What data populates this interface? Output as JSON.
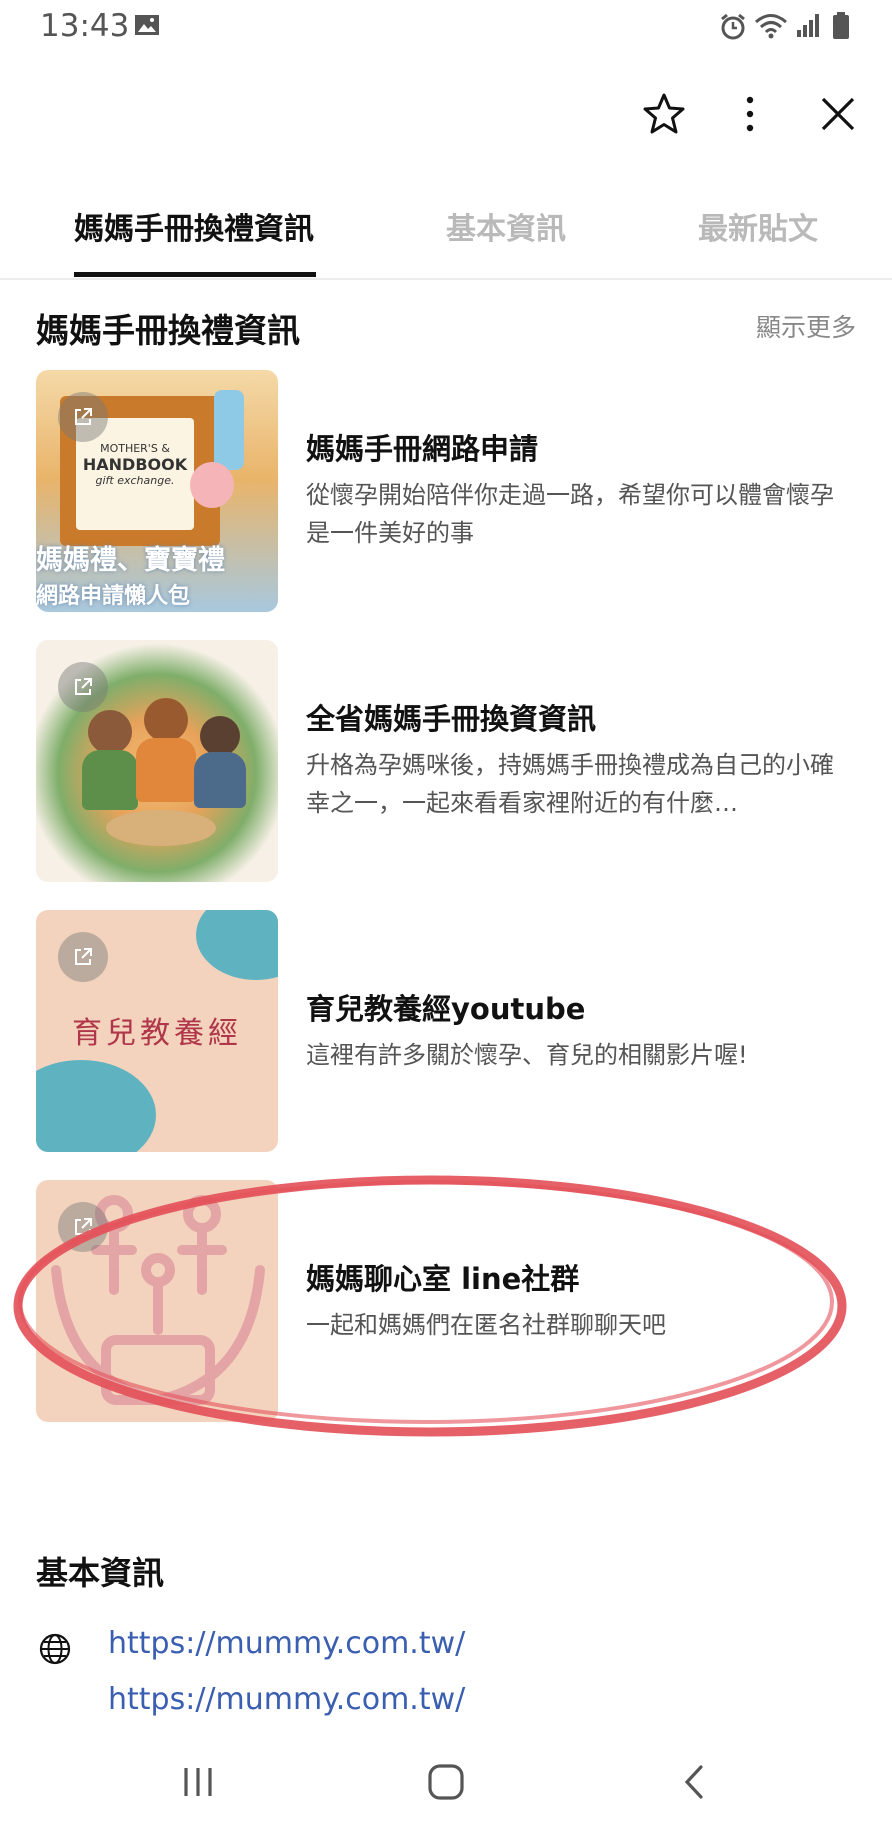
{
  "status": {
    "time": "13:43"
  },
  "tabs": [
    {
      "label": "媽媽手冊換禮資訊",
      "active": true
    },
    {
      "label": "基本資訊",
      "active": false
    },
    {
      "label": "最新貼文",
      "active": false
    }
  ],
  "section": {
    "title": "媽媽手冊換禮資訊",
    "show_more": "顯示更多"
  },
  "items": [
    {
      "title": "媽媽手冊網路申請",
      "desc": "從懷孕開始陪伴你走過一路，希望你可以體會懷孕是一件美好的事",
      "thumb": {
        "text1": "MOTHER'S &",
        "text2": "HANDBOOK",
        "text3": "gift exchange.",
        "caption1": "媽媽禮、寶寶禮",
        "caption2": "網路申請懶人包"
      }
    },
    {
      "title": "全省媽媽手冊換資資訊",
      "desc": "升格為孕媽咪後，持媽媽手冊換禮成為自己的小確幸之一，一起來看看家裡附近的有什麼…"
    },
    {
      "title": "育兒教養經youtube",
      "desc": "這裡有許多關於懷孕、育兒的相關影片喔!",
      "thumb": {
        "caption": "育兒教養經"
      }
    },
    {
      "title": "媽媽聊心室 line社群",
      "desc": "一起和媽媽們在匿名社群聊聊天吧"
    }
  ],
  "basic": {
    "title": "基本資訊",
    "links": [
      "https://mummy.com.tw/",
      "https://mummy.com.tw/"
    ]
  },
  "colors": {
    "highlight": "#e4525a",
    "link": "#3a5eb0"
  }
}
